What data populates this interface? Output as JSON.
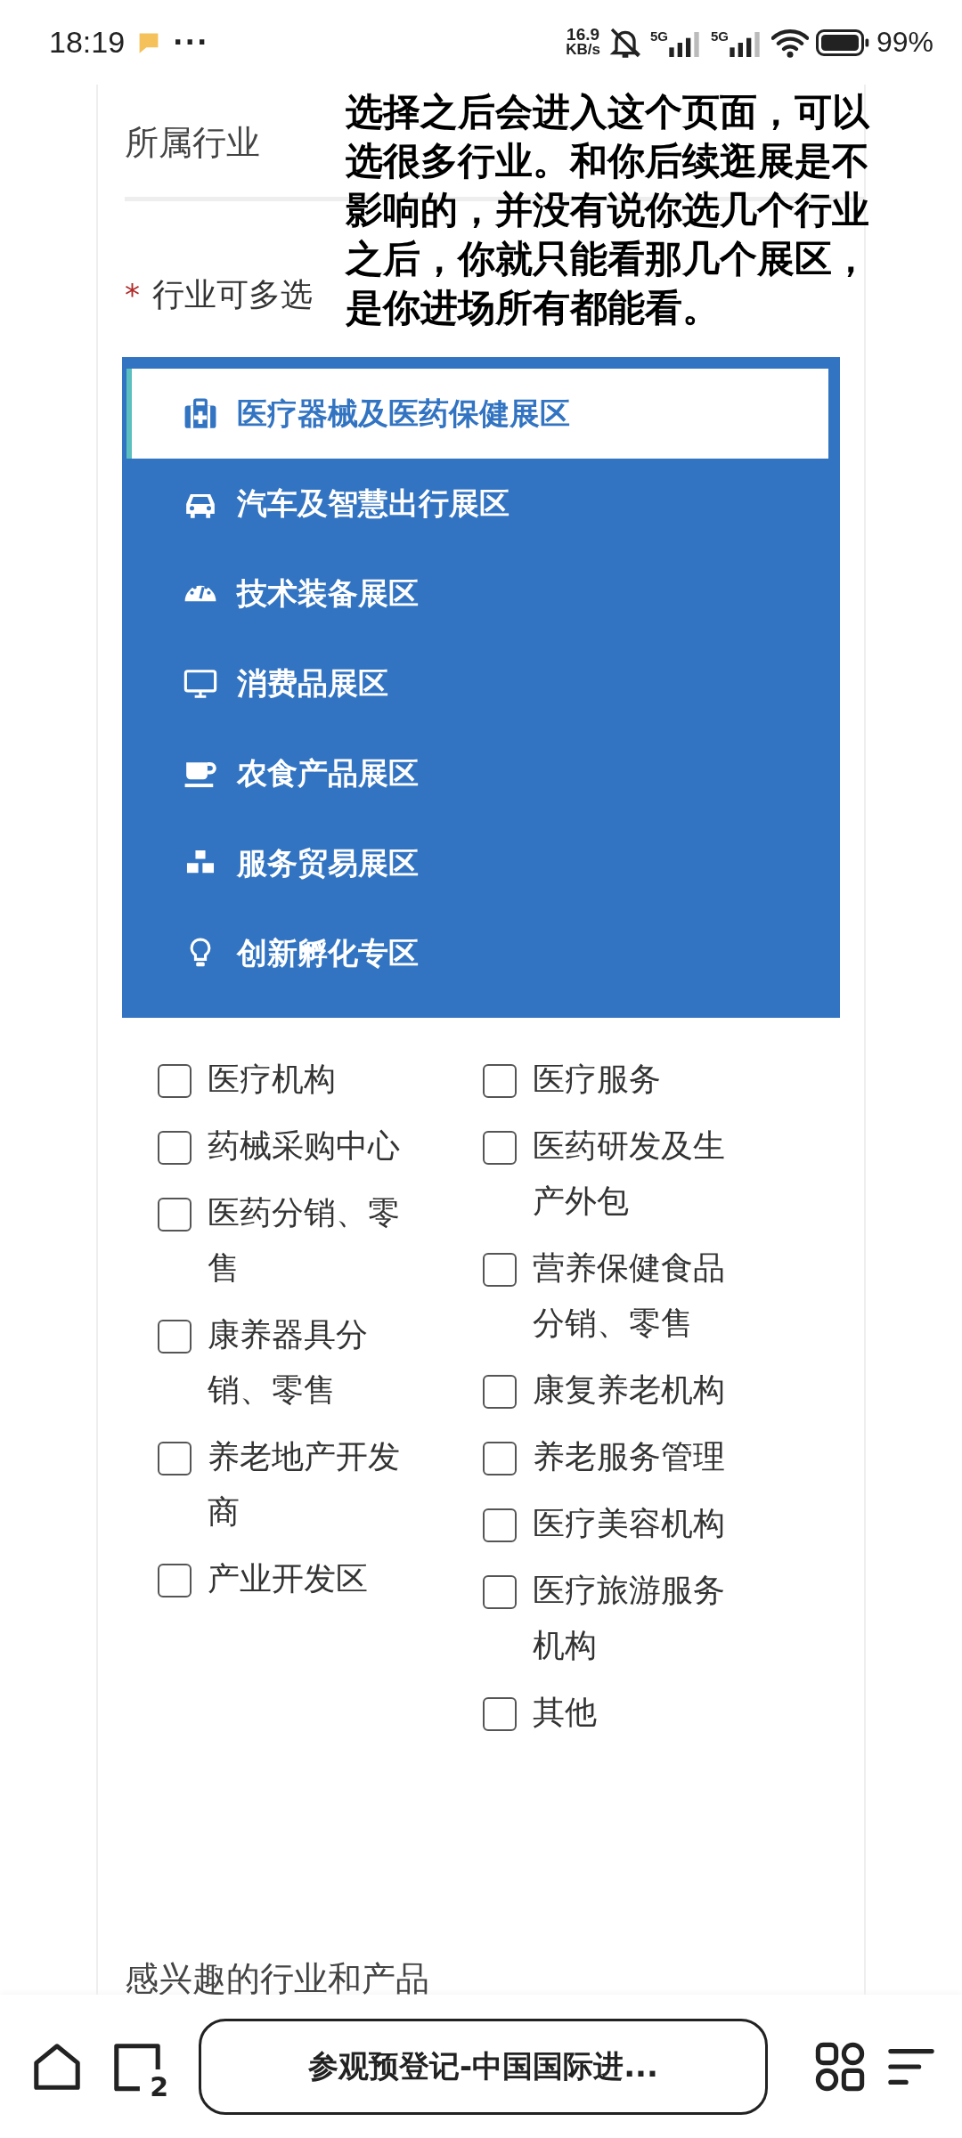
{
  "status_bar": {
    "time": "18:19",
    "more": "···",
    "speed_value": "16.9",
    "speed_unit": "KB/s",
    "sim_labels": [
      "5G",
      "5G"
    ],
    "battery": "99%"
  },
  "form": {
    "section_title": "所属行业",
    "field_label": "行业可多选",
    "required_mark": "*",
    "zones": [
      {
        "label": "医疗器械及医药保健展区",
        "selected": true
      },
      {
        "label": "汽车及智慧出行展区",
        "selected": false
      },
      {
        "label": "技术装备展区",
        "selected": false
      },
      {
        "label": "消费品展区",
        "selected": false
      },
      {
        "label": "农食产品展区",
        "selected": false
      },
      {
        "label": "服务贸易展区",
        "selected": false
      },
      {
        "label": "创新孵化专区",
        "selected": false
      }
    ],
    "option_columns": [
      [
        {
          "label": "医疗机构",
          "checked": false
        },
        {
          "label": "药械采购中心",
          "checked": false
        },
        {
          "label": "医药分销、零售",
          "checked": false
        },
        {
          "label": "康养器具分销、零售",
          "checked": false
        },
        {
          "label": "养老地产开发商",
          "checked": false
        },
        {
          "label": "产业开发区",
          "checked": false
        }
      ],
      [
        {
          "label": "医疗服务",
          "checked": false
        },
        {
          "label": "医药研发及生产外包",
          "checked": false
        },
        {
          "label": "营养保健食品分销、零售",
          "checked": false
        },
        {
          "label": "康复养老机构",
          "checked": false
        },
        {
          "label": "养老服务管理",
          "checked": false
        },
        {
          "label": "医疗美容机构",
          "checked": false
        },
        {
          "label": "医疗旅游服务机构",
          "checked": false
        },
        {
          "label": "其他",
          "checked": false
        }
      ]
    ],
    "next_section_title": "感兴趣的行业和产品"
  },
  "annotation": "选择之后会进入这个页面，可以选很多行业。和你后续逛展是不影响的，并没有说你选几个行业之后，你就只能看那几个展区，是你进场所有都能看。",
  "browser_bar": {
    "tab_count": "2",
    "address": "参观预登记-中国国际进..."
  }
}
